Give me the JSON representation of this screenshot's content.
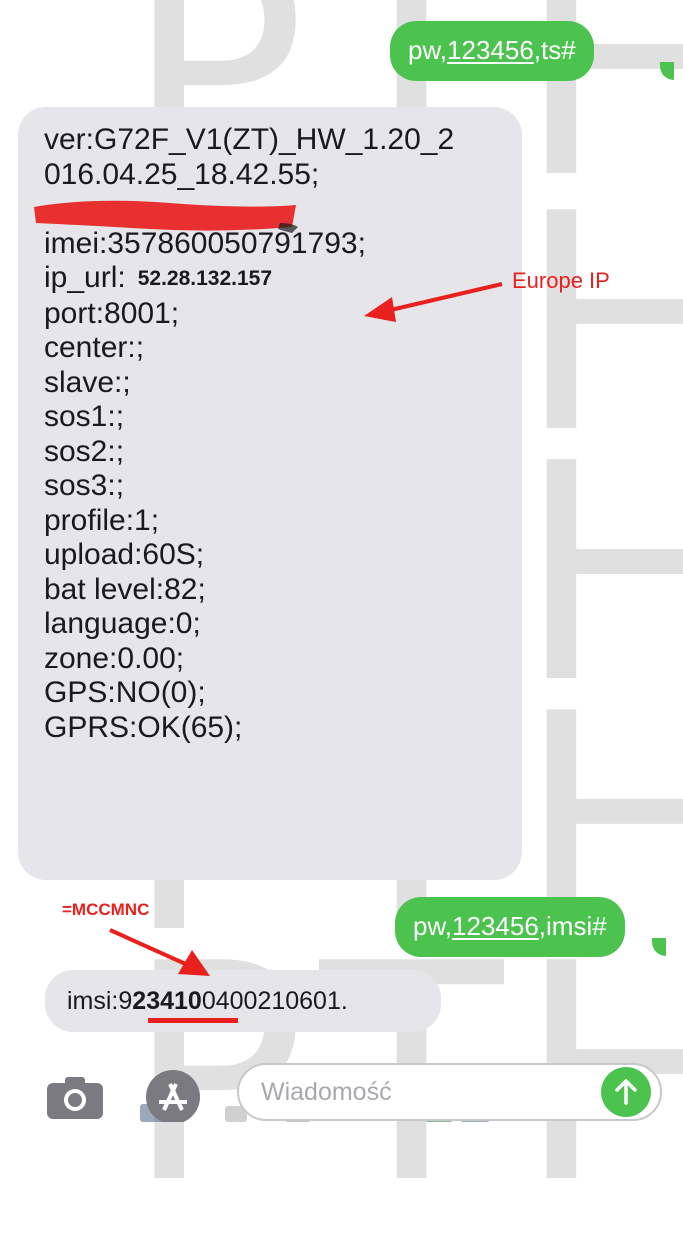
{
  "watermark": {
    "text": "PTHT",
    "rows": [
      "PTHT",
      "PTHT",
      "PTHT",
      "PTHT",
      "PTHT"
    ]
  },
  "messages": {
    "sent_1": {
      "prefix": "pw,",
      "code": "123456",
      "suffix": ",ts#"
    },
    "received_status": {
      "lines": [
        "ver:G72F_V1(ZT)_HW_1.20_2",
        "016.04.25_18.42.55;",
        "",
        "imei:357860050791793;",
        "ip_url:",
        "port:8001;",
        "center:;",
        "slave:;",
        "sos1:;",
        "sos2:;",
        "sos3:;",
        "profile:1;",
        "upload:60S;",
        "bat level:82;",
        "language:0;",
        "zone:0.00;",
        "GPS:NO(0);",
        "GPRS:OK(65);"
      ],
      "ip_value": "52.28.132.157"
    },
    "sent_2": {
      "prefix": "pw,",
      "code": "123456",
      "suffix": ",imsi#"
    },
    "received_imsi": {
      "prefix": "imsi:9",
      "highlight": "23410",
      "suffix": "0400210601."
    }
  },
  "annotations": {
    "europe_ip": "Europe IP",
    "mccmnc": "=MCCMNC"
  },
  "input_bar": {
    "placeholder": "Wiadomość",
    "camera_icon": "camera-icon",
    "appstore_icon": "app-store-icon",
    "send_icon": "arrow-up-icon"
  },
  "colors": {
    "sent_bubble": "#4cc24f",
    "received_bubble": "#e5e5ea",
    "annotation_red": "#e8211f",
    "redaction_red": "#e8211f"
  }
}
